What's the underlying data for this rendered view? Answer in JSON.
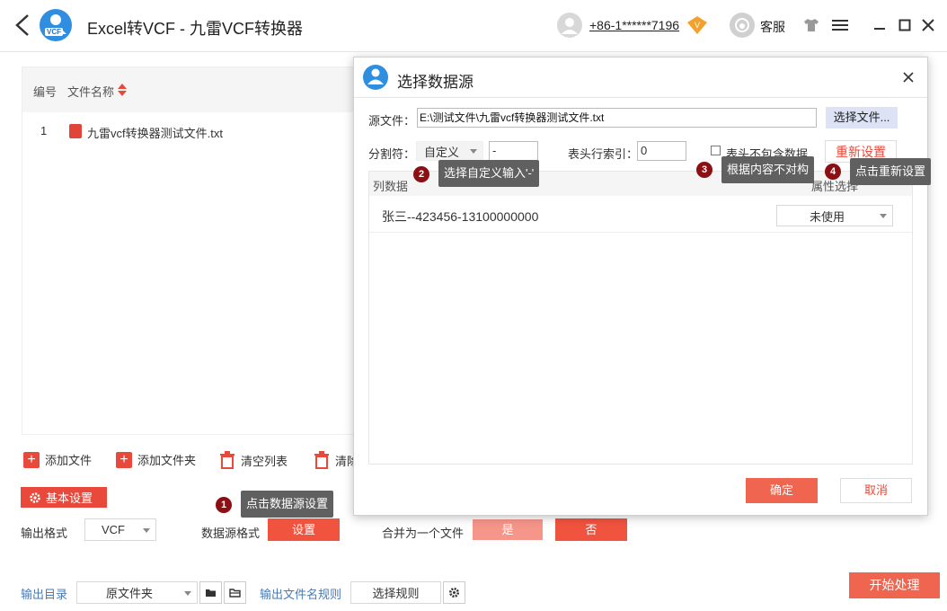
{
  "titlebar": {
    "title": "Excel转VCF - 九雷VCF转换器",
    "logo_text": "VCF",
    "phone": "+86-1******7196",
    "vip_badge": "V",
    "service": "客服"
  },
  "file_table": {
    "col_no": "编号",
    "col_name": "文件名称",
    "rows": [
      {
        "no": "1",
        "name": "九雷vcf转换器测试文件.txt"
      }
    ]
  },
  "actions": {
    "add_file": "添加文件",
    "add_folder": "添加文件夹",
    "clear_list": "清空列表",
    "remove": "清除"
  },
  "settings": {
    "basic": "基本设置",
    "output_format_label": "输出格式",
    "output_format_value": "VCF",
    "source_format_label": "数据源格式",
    "source_format_button": "设置",
    "merge_label": "合并为一个文件",
    "merge_yes": "是",
    "merge_no": "否",
    "output_dir_label": "输出目录",
    "output_dir_value": "原文件夹",
    "filename_rule_label": "输出文件名规则",
    "filename_rule_button": "选择规则",
    "start_button": "开始处理"
  },
  "dialog": {
    "title": "选择数据源",
    "source_label": "源文件：",
    "source_value": "E:\\测试文件\\九雷vcf转换器测试文件.txt",
    "choose_file": "选择文件...",
    "delimiter_label": "分割符：",
    "delimiter_mode": "自定义",
    "delimiter_value": "-",
    "header_index_label": "表头行索引：",
    "header_index_value": "0",
    "header_no_data_label": "表头不包含数据",
    "reset": "重新设置",
    "col_data": "列数据",
    "attr_select": "属性选择",
    "rows": [
      {
        "data": "张三--423456-13100000000",
        "attr": "未使用"
      }
    ],
    "ok": "确定",
    "cancel": "取消"
  },
  "tips": [
    {
      "step": "1",
      "text": "点击数据源设置"
    },
    {
      "step": "2",
      "text": "选择自定义输入'-'"
    },
    {
      "step": "3",
      "text": "根据内容不对构"
    },
    {
      "step": "4",
      "text": "点击重新设置"
    }
  ],
  "colors": {
    "accent": "#f0533e",
    "accent_light": "#f6958a",
    "tip_bg": "#606060",
    "step_bg": "#8b0f13",
    "logo_blue": "#2f8ee0"
  }
}
